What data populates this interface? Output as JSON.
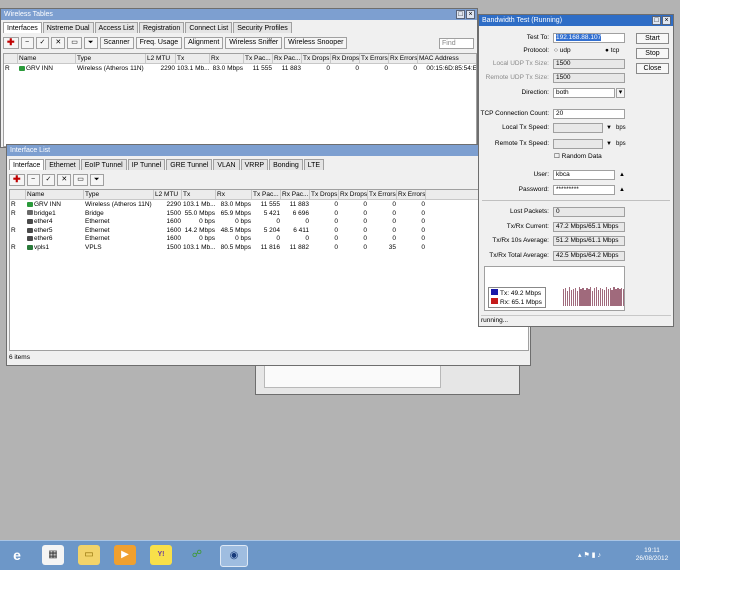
{
  "colors": {
    "title_active": "#2e6dc6",
    "title_inactive": "#7d9fd0",
    "tx": "#1a1aa8",
    "rx": "#c41b1b",
    "graph_bar": "#a06a7c"
  },
  "wireless": {
    "title": "Wireless Tables",
    "tabs": [
      "Interfaces",
      "Nstreme Dual",
      "Access List",
      "Registration",
      "Connect List",
      "Security Profiles"
    ],
    "toolbar": {
      "scanner": "Scanner",
      "freq": "Freq. Usage",
      "align": "Alignment",
      "sniffer": "Wireless Sniffer",
      "snooper": "Wireless Snooper"
    },
    "find": "Find",
    "columns": [
      "Name",
      "Type",
      "L2 MTU",
      "Tx",
      "Rx",
      "Tx Pac...",
      "Rx Pac...",
      "Tx Drops",
      "Rx Drops",
      "Tx Errors",
      "Rx Errors",
      "MAC Address"
    ],
    "rows": [
      [
        "R",
        "GRV INN",
        "Wireless (Atheros 11N)",
        "2290",
        "103.1 Mb...",
        "83.0 Mbps",
        "11 555",
        "11 883",
        "0",
        "0",
        "0",
        "0",
        "00:15:6D:85:54:E"
      ]
    ]
  },
  "iflist": {
    "title": "Interface List",
    "tabs": [
      "Interface",
      "Ethernet",
      "EoIP Tunnel",
      "IP Tunnel",
      "GRE Tunnel",
      "VLAN",
      "VRRP",
      "Bonding",
      "LTE"
    ],
    "columns": [
      "Name",
      "Type",
      "L2 MTU",
      "Tx",
      "Rx",
      "Tx Pac...",
      "Rx Pac...",
      "Tx Drops",
      "Rx Drops",
      "Tx Errors",
      "Rx Errors"
    ],
    "rows": [
      [
        "R",
        "GRV INN",
        "Wireless (Atheros 11N)",
        "2290",
        "103.1 Mb...",
        "83.0 Mbps",
        "11 555",
        "11 883",
        "0",
        "0",
        "0",
        "0"
      ],
      [
        "R",
        "bridge1",
        "Bridge",
        "1500",
        "55.0 Mbps",
        "65.9 Mbps",
        "5 421",
        "6 696",
        "0",
        "0",
        "0",
        "0"
      ],
      [
        "",
        "ether4",
        "Ethernet",
        "1600",
        "0 bps",
        "0 bps",
        "0",
        "0",
        "0",
        "0",
        "0",
        "0"
      ],
      [
        "R",
        "ether5",
        "Ethernet",
        "1600",
        "14.2 Mbps",
        "48.5 Mbps",
        "5 204",
        "6 411",
        "0",
        "0",
        "0",
        "0"
      ],
      [
        "",
        "ether6",
        "Ethernet",
        "1600",
        "0 bps",
        "0 bps",
        "0",
        "0",
        "0",
        "0",
        "0",
        "0"
      ],
      [
        "R",
        "vpls1",
        "VPLS",
        "1500",
        "103.1 Mb...",
        "80.5 Mbps",
        "11 816",
        "11 882",
        "0",
        "0",
        "35",
        "0"
      ]
    ],
    "status": "6 items"
  },
  "bw": {
    "title": "Bandwidth Test (Running)",
    "test_to_label": "Test To:",
    "test_to": "192.168.88.107",
    "protocol_label": "Protocol:",
    "udp": "udp",
    "tcp": "tcp",
    "local_udp_label": "Local UDP Tx Size:",
    "local_udp": "1500",
    "remote_udp_label": "Remote UDP Tx Size:",
    "remote_udp": "1500",
    "direction_label": "Direction:",
    "direction": "both",
    "tcp_conn_label": "TCP Connection Count:",
    "tcp_conn": "20",
    "local_speed_label": "Local Tx Speed:",
    "remote_speed_label": "Remote Tx Speed:",
    "bps": "bps",
    "random_label": "Random Data",
    "user_label": "User:",
    "user": "kbca",
    "password_label": "Password:",
    "password": "*********",
    "lost_label": "Lost Packets:",
    "lost": "0",
    "current_label": "Tx/Rx Current:",
    "current": "47.2 Mbps/65.1 Mbps",
    "avg10_label": "Tx/Rx 10s Average:",
    "avg10": "51.2 Mbps/61.1 Mbps",
    "total_label": "Tx/Rx Total Average:",
    "total": "42.5 Mbps/64.2 Mbps",
    "legend_tx": "Tx:  49.2 Mbps",
    "legend_rx": "Rx:  65.1 Mbps",
    "buttons": {
      "start": "Start",
      "stop": "Stop",
      "close": "Close"
    },
    "status": "running...",
    "graph_levels": [
      0.78,
      0.82,
      0.7,
      0.88,
      0.75,
      0.8,
      0.86,
      0.72,
      0.9,
      0.77,
      0.83,
      0.74,
      0.85,
      0.79,
      0.88,
      0.7,
      0.82,
      0.9,
      0.76,
      0.84,
      0.8,
      0.73,
      0.87,
      0.78,
      0.82,
      0.75,
      0.89,
      0.8,
      0.84,
      0.77,
      0.86,
      0.81
    ]
  },
  "taskbar": {
    "time": "19:11",
    "date": "26/08/2012",
    "icons": [
      "ie-icon",
      "media-center-icon",
      "explorer-icon",
      "media-player-icon",
      "yahoo-messenger-icon",
      "network-icon",
      "winbox-icon"
    ]
  }
}
